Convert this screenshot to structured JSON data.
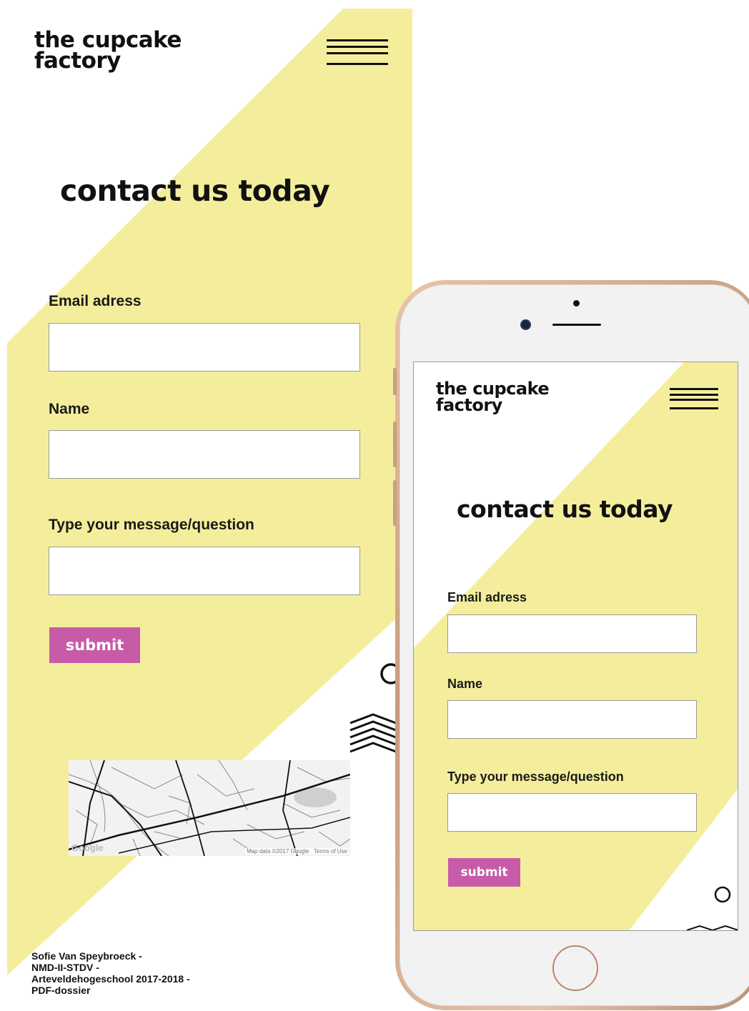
{
  "colors": {
    "yellow": "#f4ee9c",
    "accent": "#c75ba8",
    "text": "#111111"
  },
  "desktop": {
    "logo_line1": "the cupcake",
    "logo_line2": "factory",
    "menu_icon": "hamburger-menu-icon",
    "title": "contact us today",
    "email_label": "Email adress",
    "name_label": "Name",
    "message_label": "Type your message/question",
    "submit_label": "submit",
    "map_attribution": "Map data ©2017 Google   Terms of Use",
    "map_logo": "Google",
    "credits": [
      "Sofie Van Speybroeck -",
      "NMD-II-STDV -",
      "Arteveldehogeschool 2017-2018 -",
      "PDF-dossier"
    ]
  },
  "mobile": {
    "logo_line1": "the cupcake",
    "logo_line2": "factory",
    "menu_icon": "hamburger-menu-icon",
    "title": "contact us today",
    "email_label": "Email adress",
    "name_label": "Name",
    "message_label": "Type your message/question",
    "submit_label": "submit"
  }
}
